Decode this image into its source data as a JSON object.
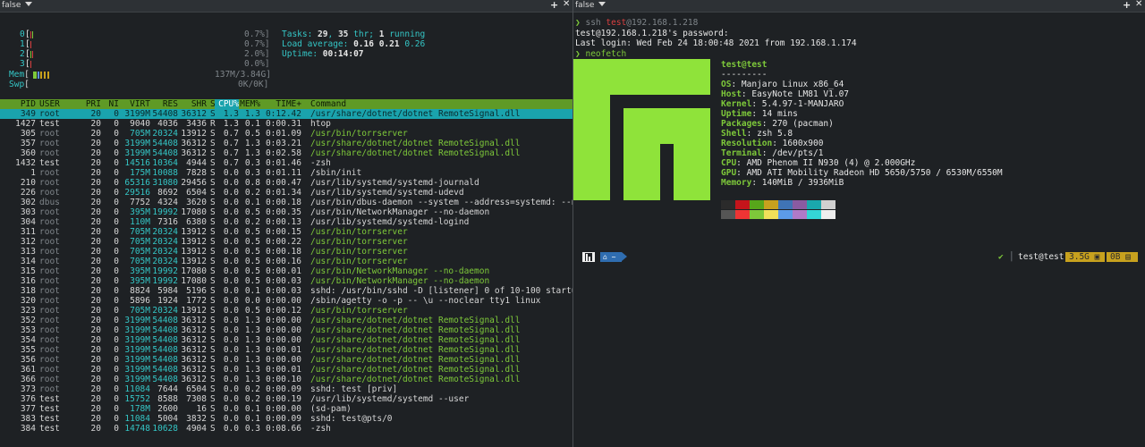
{
  "left_tab": {
    "title": "false"
  },
  "right_tab": {
    "title": "false"
  },
  "htop": {
    "cpus": [
      {
        "label": "0",
        "pct": "0.7%]"
      },
      {
        "label": "1",
        "pct": "0.7%]"
      },
      {
        "label": "2",
        "pct": "2.0%]"
      },
      {
        "label": "3",
        "pct": "0.0%]"
      }
    ],
    "mem_label": "Mem",
    "mem_value": "137M/3.84G]",
    "swp_label": "Swp",
    "swp_value": "0K/0K]",
    "tasks_label": "Tasks: ",
    "tasks": "29",
    "thr": "35",
    "running": "1",
    "load_label": "Load average: ",
    "load1": "0.16",
    "load5": "0.21",
    "load15": "0.26",
    "uptime_label": "Uptime: ",
    "uptime": "00:14:07",
    "columns": [
      "PID",
      "USER",
      "PRI",
      "NI",
      "VIRT",
      "RES",
      "SHR",
      "S",
      "CPU%",
      "MEM%",
      "TIME+",
      "Command"
    ],
    "processes": [
      [
        "349",
        "root",
        "20",
        "0",
        "3199M",
        "54408",
        "36312",
        "S",
        "1.3",
        "1.3",
        "0:12.42",
        "/usr/share/dotnet/dotnet RemoteSignal.dll"
      ],
      [
        "1427",
        "test",
        "20",
        "0",
        "9040",
        "4036",
        "3436",
        "R",
        "1.3",
        "0.1",
        "0:00.31",
        "htop"
      ],
      [
        "305",
        "root",
        "20",
        "0",
        "705M",
        "20324",
        "13912",
        "S",
        "0.7",
        "0.5",
        "0:01.09",
        "/usr/bin/torrserver"
      ],
      [
        "357",
        "root",
        "20",
        "0",
        "3199M",
        "54408",
        "36312",
        "S",
        "0.7",
        "1.3",
        "0:03.21",
        "/usr/share/dotnet/dotnet RemoteSignal.dll"
      ],
      [
        "360",
        "root",
        "20",
        "0",
        "3199M",
        "54408",
        "36312",
        "S",
        "0.7",
        "1.3",
        "0:02.58",
        "/usr/share/dotnet/dotnet RemoteSignal.dll"
      ],
      [
        "1432",
        "test",
        "20",
        "0",
        "14516",
        "10364",
        "4944",
        "S",
        "0.7",
        "0.3",
        "0:01.46",
        "-zsh"
      ],
      [
        "1",
        "root",
        "20",
        "0",
        "175M",
        "10088",
        "7828",
        "S",
        "0.0",
        "0.3",
        "0:01.11",
        "/sbin/init"
      ],
      [
        "210",
        "root",
        "20",
        "0",
        "65316",
        "31080",
        "29456",
        "S",
        "0.0",
        "0.8",
        "0:00.47",
        "/usr/lib/systemd/systemd-journald"
      ],
      [
        "226",
        "root",
        "20",
        "0",
        "29516",
        "8692",
        "6504",
        "S",
        "0.0",
        "0.2",
        "0:01.34",
        "/usr/lib/systemd/systemd-udevd"
      ],
      [
        "302",
        "dbus",
        "20",
        "0",
        "7752",
        "4324",
        "3620",
        "S",
        "0.0",
        "0.1",
        "0:00.18",
        "/usr/bin/dbus-daemon --system --address=systemd: --nof"
      ],
      [
        "303",
        "root",
        "20",
        "0",
        "395M",
        "19992",
        "17080",
        "S",
        "0.0",
        "0.5",
        "0:00.35",
        "/usr/bin/NetworkManager --no-daemon"
      ],
      [
        "304",
        "root",
        "20",
        "0",
        "110M",
        "7316",
        "6380",
        "S",
        "0.0",
        "0.2",
        "0:00.13",
        "/usr/lib/systemd/systemd-logind"
      ],
      [
        "311",
        "root",
        "20",
        "0",
        "705M",
        "20324",
        "13912",
        "S",
        "0.0",
        "0.5",
        "0:00.15",
        "/usr/bin/torrserver"
      ],
      [
        "312",
        "root",
        "20",
        "0",
        "705M",
        "20324",
        "13912",
        "S",
        "0.0",
        "0.5",
        "0:00.22",
        "/usr/bin/torrserver"
      ],
      [
        "313",
        "root",
        "20",
        "0",
        "705M",
        "20324",
        "13912",
        "S",
        "0.0",
        "0.5",
        "0:00.18",
        "/usr/bin/torrserver"
      ],
      [
        "314",
        "root",
        "20",
        "0",
        "705M",
        "20324",
        "13912",
        "S",
        "0.0",
        "0.5",
        "0:00.16",
        "/usr/bin/torrserver"
      ],
      [
        "315",
        "root",
        "20",
        "0",
        "395M",
        "19992",
        "17080",
        "S",
        "0.0",
        "0.5",
        "0:00.01",
        "/usr/bin/NetworkManager --no-daemon"
      ],
      [
        "316",
        "root",
        "20",
        "0",
        "395M",
        "19992",
        "17080",
        "S",
        "0.0",
        "0.5",
        "0:00.03",
        "/usr/bin/NetworkManager --no-daemon"
      ],
      [
        "318",
        "root",
        "20",
        "0",
        "8824",
        "5984",
        "5196",
        "S",
        "0.0",
        "0.1",
        "0:00.03",
        "sshd: /usr/bin/sshd -D [listener] 0 of 10-100 startups"
      ],
      [
        "320",
        "root",
        "20",
        "0",
        "5896",
        "1924",
        "1772",
        "S",
        "0.0",
        "0.0",
        "0:00.00",
        "/sbin/agetty -o -p -- \\u --noclear tty1 linux"
      ],
      [
        "323",
        "root",
        "20",
        "0",
        "705M",
        "20324",
        "13912",
        "S",
        "0.0",
        "0.5",
        "0:00.12",
        "/usr/bin/torrserver"
      ],
      [
        "352",
        "root",
        "20",
        "0",
        "3199M",
        "54408",
        "36312",
        "S",
        "0.0",
        "1.3",
        "0:00.00",
        "/usr/share/dotnet/dotnet RemoteSignal.dll"
      ],
      [
        "353",
        "root",
        "20",
        "0",
        "3199M",
        "54408",
        "36312",
        "S",
        "0.0",
        "1.3",
        "0:00.00",
        "/usr/share/dotnet/dotnet RemoteSignal.dll"
      ],
      [
        "354",
        "root",
        "20",
        "0",
        "3199M",
        "54408",
        "36312",
        "S",
        "0.0",
        "1.3",
        "0:00.00",
        "/usr/share/dotnet/dotnet RemoteSignal.dll"
      ],
      [
        "355",
        "root",
        "20",
        "0",
        "3199M",
        "54408",
        "36312",
        "S",
        "0.0",
        "1.3",
        "0:00.01",
        "/usr/share/dotnet/dotnet RemoteSignal.dll"
      ],
      [
        "356",
        "root",
        "20",
        "0",
        "3199M",
        "54408",
        "36312",
        "S",
        "0.0",
        "1.3",
        "0:00.00",
        "/usr/share/dotnet/dotnet RemoteSignal.dll"
      ],
      [
        "361",
        "root",
        "20",
        "0",
        "3199M",
        "54408",
        "36312",
        "S",
        "0.0",
        "1.3",
        "0:00.01",
        "/usr/share/dotnet/dotnet RemoteSignal.dll"
      ],
      [
        "366",
        "root",
        "20",
        "0",
        "3199M",
        "54408",
        "36312",
        "S",
        "0.0",
        "1.3",
        "0:00.10",
        "/usr/share/dotnet/dotnet RemoteSignal.dll"
      ],
      [
        "373",
        "root",
        "20",
        "0",
        "11084",
        "7644",
        "6504",
        "S",
        "0.0",
        "0.2",
        "0:00.09",
        "sshd: test [priv]"
      ],
      [
        "376",
        "test",
        "20",
        "0",
        "15752",
        "8588",
        "7308",
        "S",
        "0.0",
        "0.2",
        "0:00.19",
        "/usr/lib/systemd/systemd --user"
      ],
      [
        "377",
        "test",
        "20",
        "0",
        "178M",
        "2600",
        "16",
        "S",
        "0.0",
        "0.1",
        "0:00.00",
        "(sd-pam)"
      ],
      [
        "383",
        "test",
        "20",
        "0",
        "11084",
        "5004",
        "3832",
        "S",
        "0.0",
        "0.1",
        "0:00.09",
        "sshd: test@pts/0"
      ],
      [
        "384",
        "test",
        "20",
        "0",
        "14748",
        "10628",
        "4904",
        "S",
        "0.0",
        "0.3",
        "0:08.66",
        "-zsh"
      ]
    ]
  },
  "terminal": {
    "prompt_glyph": "❯",
    "ssh_cmd": "ssh",
    "ssh_user": "test",
    "ssh_host": "@192.168.1.218",
    "password_prompt": "test@192.168.1.218's password:",
    "last_login": "Last login: Wed Feb 24 18:00:48 2021 from 192.168.1.174",
    "neofetch_cmd": "neofetch",
    "userhost": "test@test",
    "separator": "---------",
    "info": [
      {
        "key": "OS",
        "value": "Manjaro Linux x86_64"
      },
      {
        "key": "Host",
        "value": "EasyNote LM81 V1.07"
      },
      {
        "key": "Kernel",
        "value": "5.4.97-1-MANJARO"
      },
      {
        "key": "Uptime",
        "value": "14 mins"
      },
      {
        "key": "Packages",
        "value": "270 (pacman)"
      },
      {
        "key": "Shell",
        "value": "zsh 5.8"
      },
      {
        "key": "Resolution",
        "value": "1600x900"
      },
      {
        "key": "Terminal",
        "value": "/dev/pts/1"
      },
      {
        "key": "CPU",
        "value": "AMD Phenom II N930 (4) @ 2.000GHz"
      },
      {
        "key": "GPU",
        "value": "AMD ATI Mobility Radeon HD 5650/5750 / 6530M/6550M"
      },
      {
        "key": "Memory",
        "value": "140MiB / 3936MiB"
      }
    ],
    "palette_top": [
      "#2b2b2b",
      "#c4141b",
      "#57a61a",
      "#c7a11e",
      "#3f74b5",
      "#8a5ba1",
      "#1aa8ad",
      "#d0d0d0"
    ],
    "palette_bottom": [
      "#555555",
      "#ee3434",
      "#7ec93a",
      "#f1e05a",
      "#5c9be8",
      "#b07ac8",
      "#34d6d6",
      "#eeeeee"
    ],
    "status_check": "✔",
    "status_user": "test@test",
    "status_mem": "3.5G",
    "status_swap": "0B",
    "prompt_home": "~"
  },
  "colors": {
    "accent_green": "#7ec93a",
    "selection": "#1aa3ad",
    "header": "#5f9a26"
  }
}
